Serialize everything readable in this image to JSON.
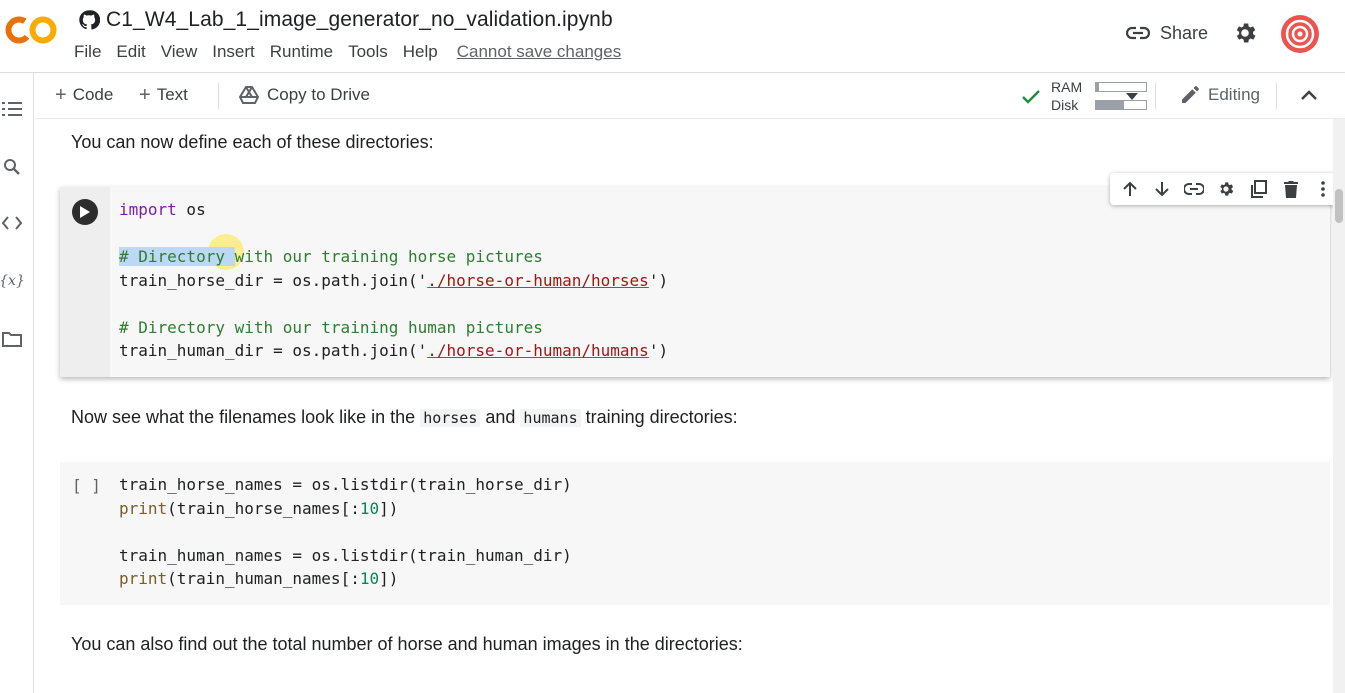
{
  "app": {
    "logo_text": "CO",
    "notebook_title": "C1_W4_Lab_1_image_generator_no_validation.ipynb",
    "menu": [
      "File",
      "Edit",
      "View",
      "Insert",
      "Runtime",
      "Tools",
      "Help"
    ],
    "save_status": "Cannot save changes",
    "share_label": "Share"
  },
  "toolbar": {
    "code_label": "Code",
    "text_label": "Text",
    "copy_to_drive_label": "Copy to Drive",
    "ram_label": "RAM",
    "disk_label": "Disk",
    "ram_usage": 0.05,
    "disk_usage": 0.55,
    "editing_label": "Editing"
  },
  "content": {
    "text1": "You can now define each of these directories:",
    "cell1": {
      "line1_kw": "import",
      "line1_rest": " os",
      "line3_comment_hl": "# Directory ",
      "line3_comment_rest": "with our training horse pictures",
      "line4_var": "train_horse_dir = os.path.join('",
      "line4_str": "./horse-or-human/horses",
      "line4_end": "')",
      "line6_comment": "# Directory with our training human pictures",
      "line7_var": "train_human_dir = os.path.join('",
      "line7_str": "./horse-or-human/humans",
      "line7_end": "')"
    },
    "text2_pre": "Now see what the filenames look like in the ",
    "text2_code1": "horses",
    "text2_mid": " and ",
    "text2_code2": "humans",
    "text2_post": " training directories:",
    "cell2": {
      "exec_count": "[ ]",
      "line1": "train_horse_names = os.listdir(train_horse_dir)",
      "line2_fn": "print",
      "line2_a": "(train_horse_names[:",
      "line2_num": "10",
      "line2_b": "])",
      "line4": "train_human_names = os.listdir(train_human_dir)",
      "line5_fn": "print",
      "line5_a": "(train_human_names[:",
      "line5_num": "10",
      "line5_b": "])"
    },
    "text3": "You can also find out the total number of horse and human images in the directories:"
  },
  "colors": {
    "colab_orange": "#f9ab00",
    "colab_orange_dark": "#e8710a",
    "check_green": "#1e8e3e",
    "avatar_red": "#e53935"
  }
}
